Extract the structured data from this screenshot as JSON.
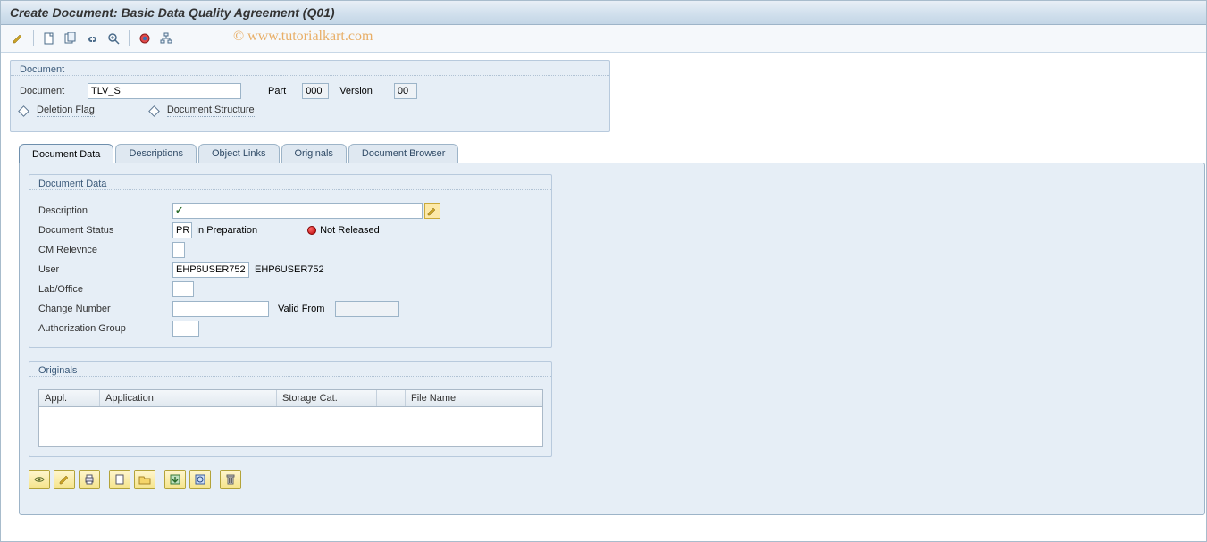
{
  "title": "Create Document: Basic Data Quality Agreement (Q01)",
  "watermark": "© www.tutorialkart.com",
  "doc_header": {
    "group_label": "Document",
    "doc_label": "Document",
    "doc_value": "TLV_S",
    "part_label": "Part",
    "part_value": "000",
    "version_label": "Version",
    "version_value": "00",
    "deletion_flag": "Deletion Flag",
    "doc_structure": "Document Structure"
  },
  "tabs": {
    "data": "Document Data",
    "descriptions": "Descriptions",
    "object_links": "Object Links",
    "originals": "Originals",
    "browser": "Document Browser"
  },
  "doc_data": {
    "group_label": "Document Data",
    "description_label": "Description",
    "description_value": "",
    "status_label": "Document Status",
    "status_code": "PR",
    "status_text": "In Preparation",
    "status_release": "Not Released",
    "cm_label": "CM Relevnce",
    "cm_value": "",
    "user_label": "User",
    "user_value": "EHP6USER752",
    "user_text": "EHP6USER752",
    "lab_label": "Lab/Office",
    "lab_value": "",
    "change_label": "Change Number",
    "change_value": "",
    "valid_from_label": "Valid From",
    "valid_from_value": "",
    "auth_label": "Authorization Group",
    "auth_value": ""
  },
  "originals": {
    "group_label": "Originals",
    "cols": {
      "appl": "Appl.",
      "application": "Application",
      "storage": "Storage Cat.",
      "filename": "File Name"
    }
  }
}
